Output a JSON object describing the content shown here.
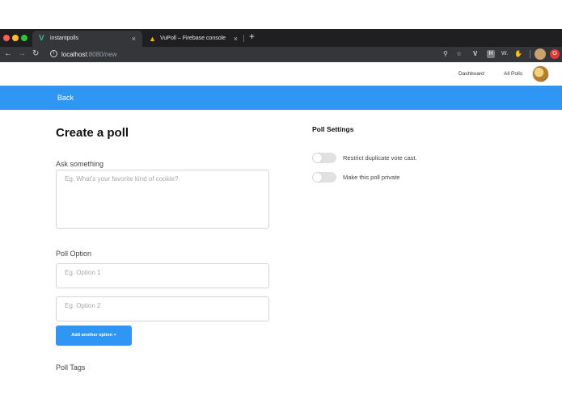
{
  "browser": {
    "tabs": [
      {
        "label": "instantpolls",
        "icon": "vue-icon",
        "active": true
      },
      {
        "label": "VuPoll – Firebase console",
        "icon": "firebase-icon",
        "active": false
      }
    ],
    "tab_close": "×",
    "new_tab": "+",
    "url_host": "localhost",
    "url_path": ":8080/new"
  },
  "header": {
    "dashboard_label": "Dashboard",
    "all_polls_label": "All Polls"
  },
  "nav": {
    "back_label": "Back"
  },
  "form": {
    "title": "Create a poll",
    "ask_label": "Ask something",
    "ask_placeholder": "Eg. What's your favorite kind of cookie?",
    "option_label": "Poll Option",
    "option1_placeholder": "Eg. Option 1",
    "option2_placeholder": "Eg. Option 2",
    "add_option_label": "Add another option +",
    "tags_label": "Poll Tags"
  },
  "settings": {
    "title": "Poll Settings",
    "options": [
      {
        "label": "Restrict duplicate vote cast.",
        "enabled": false
      },
      {
        "label": "Make this poll private",
        "enabled": false
      }
    ]
  },
  "colors": {
    "accent": "#2f96f3",
    "chrome_dark": "#1f1f21",
    "toggle_off": "#e1e1e1"
  }
}
